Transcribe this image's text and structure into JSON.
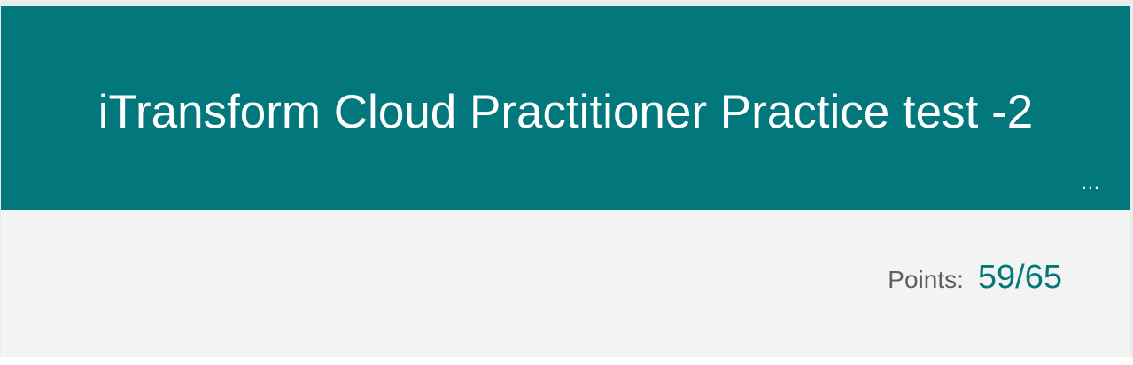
{
  "header": {
    "title": "iTransform Cloud Practitioner Practice test -2",
    "more_label": "...",
    "background_color": "#03787c"
  },
  "score": {
    "label": "Points:",
    "value": "59/65",
    "accent_color": "#03787c"
  }
}
